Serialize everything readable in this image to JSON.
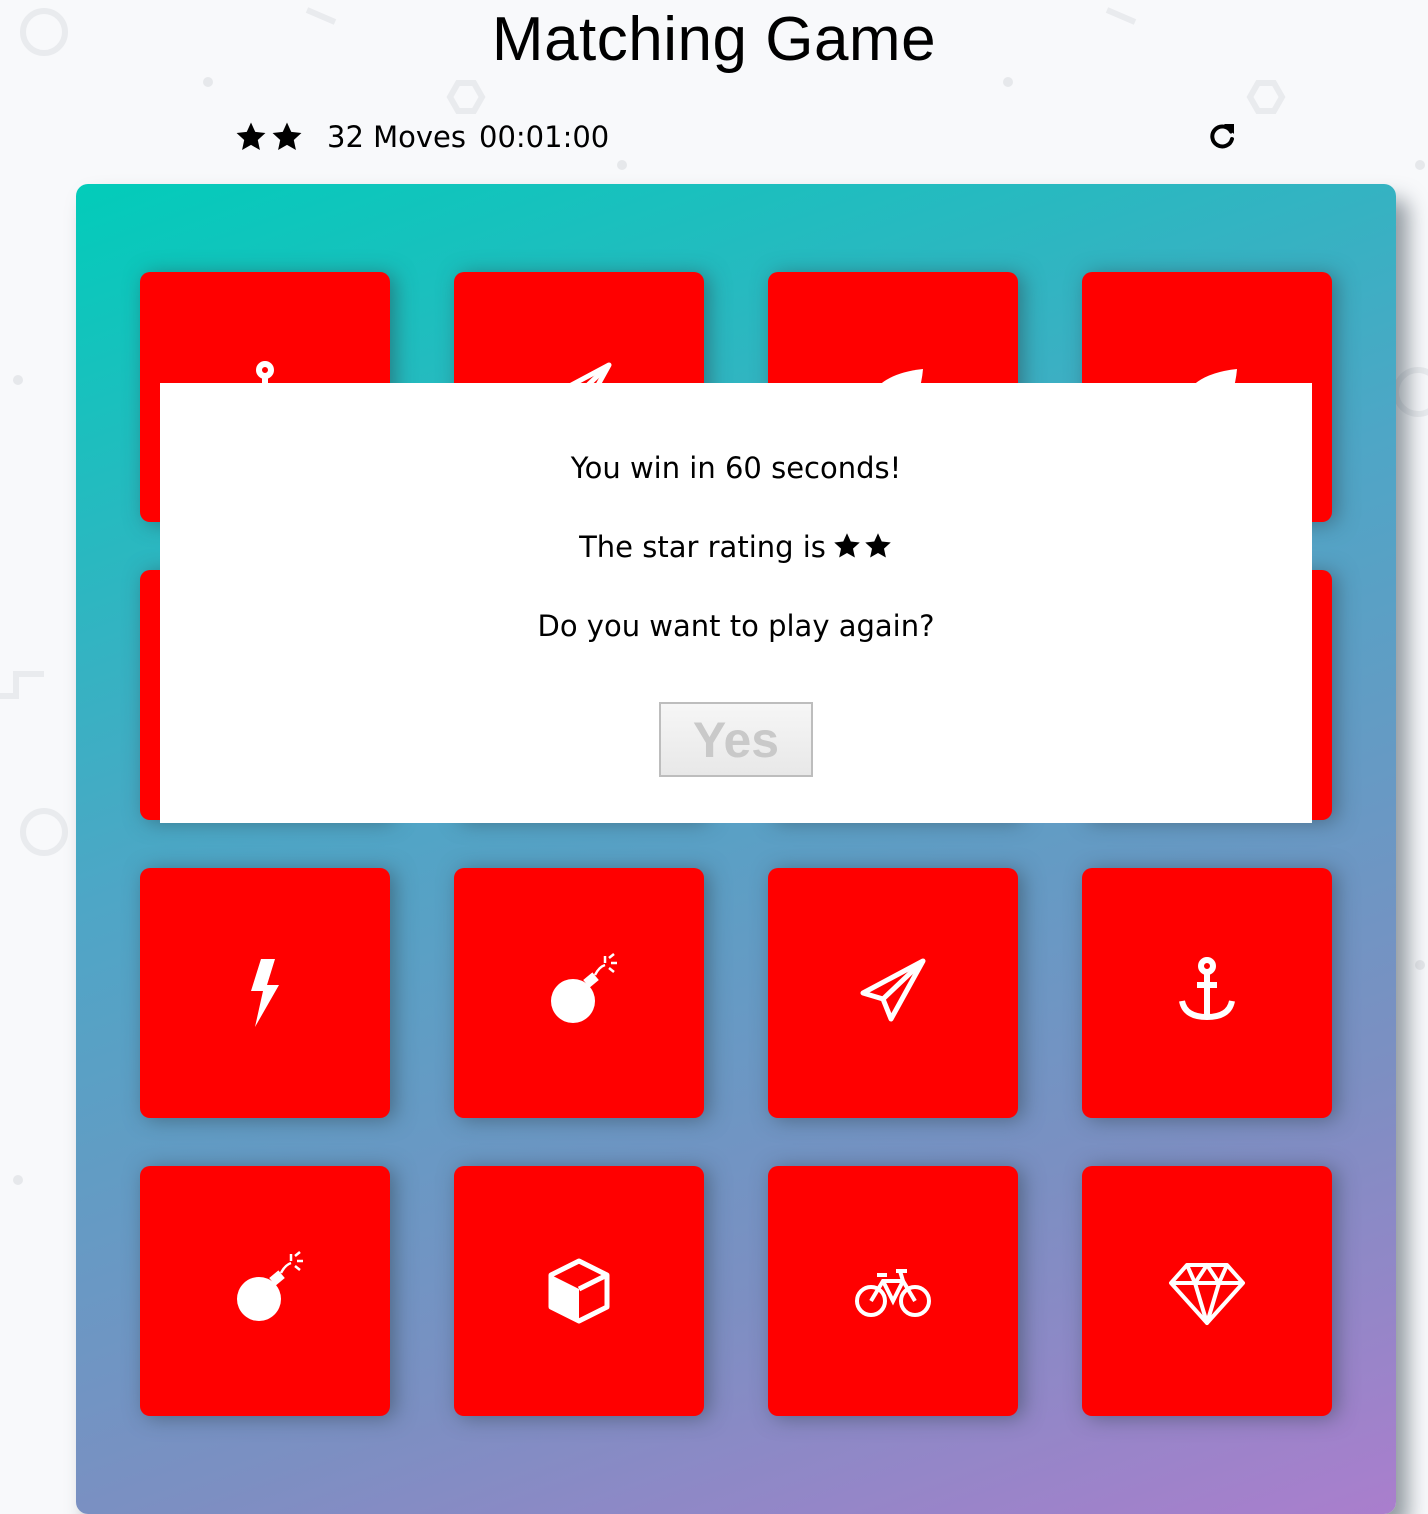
{
  "app": {
    "title": "Matching Game"
  },
  "score_panel": {
    "stars": [
      "star-icon",
      "star-icon"
    ],
    "moves_label": "32 Moves",
    "timer": "00:01:00",
    "restart_icon": "refresh-icon"
  },
  "cards": [
    {
      "icon": "anchor-icon"
    },
    {
      "icon": "paper-plane-icon"
    },
    {
      "icon": "leaf-icon"
    },
    {
      "icon": "leaf-icon"
    },
    {
      "icon": "hidden"
    },
    {
      "icon": "hidden"
    },
    {
      "icon": "hidden"
    },
    {
      "icon": "hidden"
    },
    {
      "icon": "bolt-icon"
    },
    {
      "icon": "bomb-icon"
    },
    {
      "icon": "paper-plane-icon"
    },
    {
      "icon": "anchor-icon"
    },
    {
      "icon": "bomb-icon"
    },
    {
      "icon": "cube-icon"
    },
    {
      "icon": "bicycle-icon"
    },
    {
      "icon": "diamond-icon"
    }
  ],
  "modal": {
    "win_message": "You win in 60 seconds!",
    "rating_prefix": "The star rating is",
    "rating_stars": [
      "star-icon",
      "star-icon"
    ],
    "play_again_question": "Do you want to play again?",
    "yes_label": "Yes"
  },
  "colors": {
    "card": "#ff0000",
    "deck_gradient_start": "#02ccba",
    "deck_gradient_end": "#aa7ecd",
    "modal_bg": "#ffffff"
  }
}
